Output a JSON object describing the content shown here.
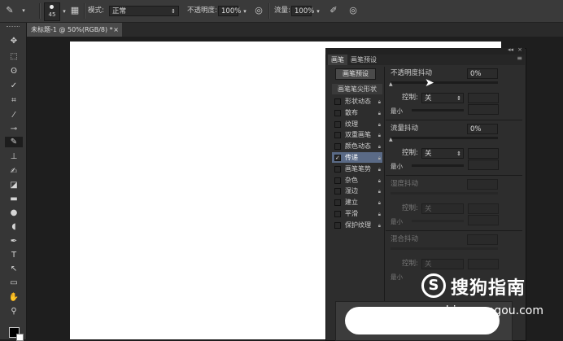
{
  "options_bar": {
    "brush_size": "45",
    "mode_label": "模式:",
    "mode_value": "正常",
    "opacity_label": "不透明度:",
    "opacity_value": "100%",
    "flow_label": "流量:",
    "flow_value": "100%"
  },
  "document_tab": {
    "title": "未标题-1 @ 50%(RGB/8) *",
    "close": "×"
  },
  "brush_panel": {
    "tabs": [
      "画笔",
      "画笔预设"
    ],
    "preset_button": "画笔预设",
    "tip_shape_header": "画笔笔尖形状",
    "options": [
      {
        "label": "形状动态",
        "checked": false
      },
      {
        "label": "散布",
        "checked": false
      },
      {
        "label": "纹理",
        "checked": false
      },
      {
        "label": "双重画笔",
        "checked": false
      },
      {
        "label": "颜色动态",
        "checked": false
      },
      {
        "label": "传递",
        "checked": true
      },
      {
        "label": "画笔笔势",
        "checked": false
      },
      {
        "label": "杂色",
        "checked": false
      },
      {
        "label": "湿边",
        "checked": false
      },
      {
        "label": "建立",
        "checked": false
      },
      {
        "label": "平滑",
        "checked": false
      },
      {
        "label": "保护纹理",
        "checked": false
      }
    ],
    "opacity_jitter": {
      "label": "不透明度抖动",
      "value": "0%"
    },
    "flow_jitter": {
      "label": "流量抖动",
      "value": "0%"
    },
    "wetness_jitter": {
      "label": "湿度抖动"
    },
    "mix_jitter": {
      "label": "混合抖动"
    },
    "control_label": "控制:",
    "control_value": "关",
    "min_label": "最小"
  },
  "watermark": {
    "text": "搜狗指南",
    "url": "zhinan.sogou.com"
  }
}
